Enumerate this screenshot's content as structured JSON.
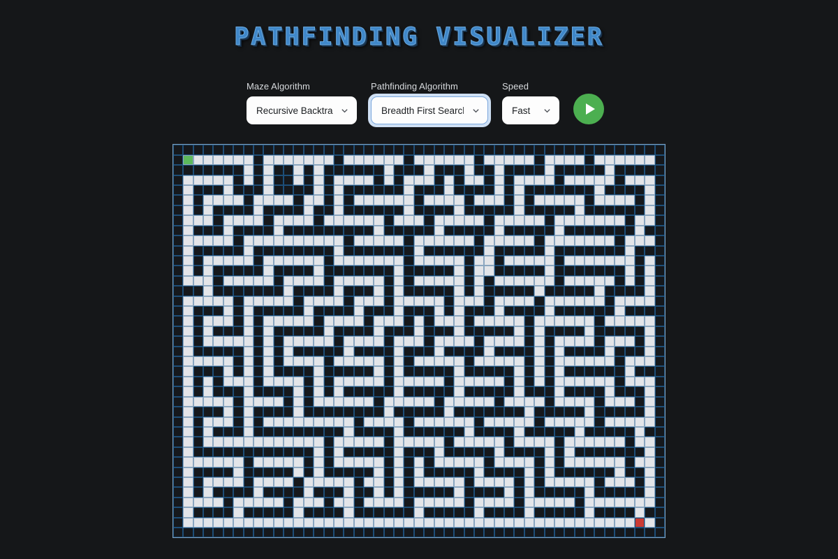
{
  "app": {
    "title": "Pathfinding Visualizer",
    "background_color": "#151719",
    "title_color": "#3f87c9"
  },
  "controls": {
    "maze": {
      "label": "Maze Algorithm",
      "value": "Recursive Backtracker",
      "options": [
        "Recursive Backtracker"
      ],
      "icon": "chevron-down-icon"
    },
    "pathfinding": {
      "label": "Pathfinding Algorithm",
      "value": "Breadth First Search",
      "options": [
        "Breadth First Search"
      ],
      "focused": true,
      "icon": "chevron-down-icon"
    },
    "speed": {
      "label": "Speed",
      "value": "Fast",
      "options": [
        "Fast"
      ],
      "icon": "chevron-down-icon"
    },
    "play": {
      "label": "Start",
      "icon": "play-icon",
      "color": "#4caf50"
    }
  },
  "maze": {
    "cols": 49,
    "rows": 39,
    "cell_size_px": 14.2,
    "start_cell": [
      1,
      1
    ],
    "end_cell": [
      48,
      38
    ],
    "colors": {
      "open": "#e3e5e9",
      "wall": "#15181c",
      "start": "#5cb85c",
      "end": "#cb3a33",
      "grid_line": "#2e5f8a"
    },
    "rows_bits": [
      "0000000000000000000000000000000000000000000000000",
      "0S11111101111111011111101111110111110111101111110",
      "0000000101001010000001000100010010000100000100000",
      "0111110101001010111101011101011010111101111101110",
      "0100010001000010100000010001000010100000001000010",
      "0101111011110110101111110111101110101111101111010",
      "0101000010000100100000010000100000100000100000010",
      "0111011110111101111110111011111011111011111110110",
      "0100010000100000000010000010000010000010000000100",
      "0111110111111111101111101111110111110111111101110",
      "0100000100000000100000001000000100000100000001000",
      "0101111101111110111111101111101101111101111111010",
      "0101000001000010000000100000101100000100000001010",
      "0111011111011110111110101111101011111101111101010",
      "0001000000010000100010100000101000001000001000010",
      "0111110111110111101110111110111011110111111011110",
      "0100010100000100001000100010100010000100000010000",
      "0101110101111101111011101011101111101111110111110",
      "0101000101000001000010001000100000101000010000010",
      "0101111101011111011110111011110111101011110111010",
      "0100000101010000010000100010000100001010000100010",
      "0111110101011110111110101111101111101011111101110",
      "0100010101000010000010100000100000101010000001000",
      "0101011101111010111110111110111110101011111101110",
      "0101000100001010100000100000100000100010000100010",
      "0111110111101011111101111101111101111011110111010",
      "0100010100001000000001000001000000010000010000010",
      "0101110101111111110111101111110111110111110111110",
      "0101000100000000010000100000010000100000100000100",
      "0101111111111110111110111110111110111101111110110",
      "0100000000000010100000100010000010000101000000010",
      "0111111011111010111110101011111011110101111110110",
      "0100001000001010000010101000001000010100000010010",
      "0101111011110111110110101111101111010111110111010",
      "0101000010000100010010100000100001010000010000010",
      "0111101111101110110111101111101111011111011111110",
      "0100001000001000010000001000001000010000010000100",
      "0111111111111111111111111111111111111111111111E10",
      "0000000000000000000000000000000000000000000000000"
    ]
  }
}
